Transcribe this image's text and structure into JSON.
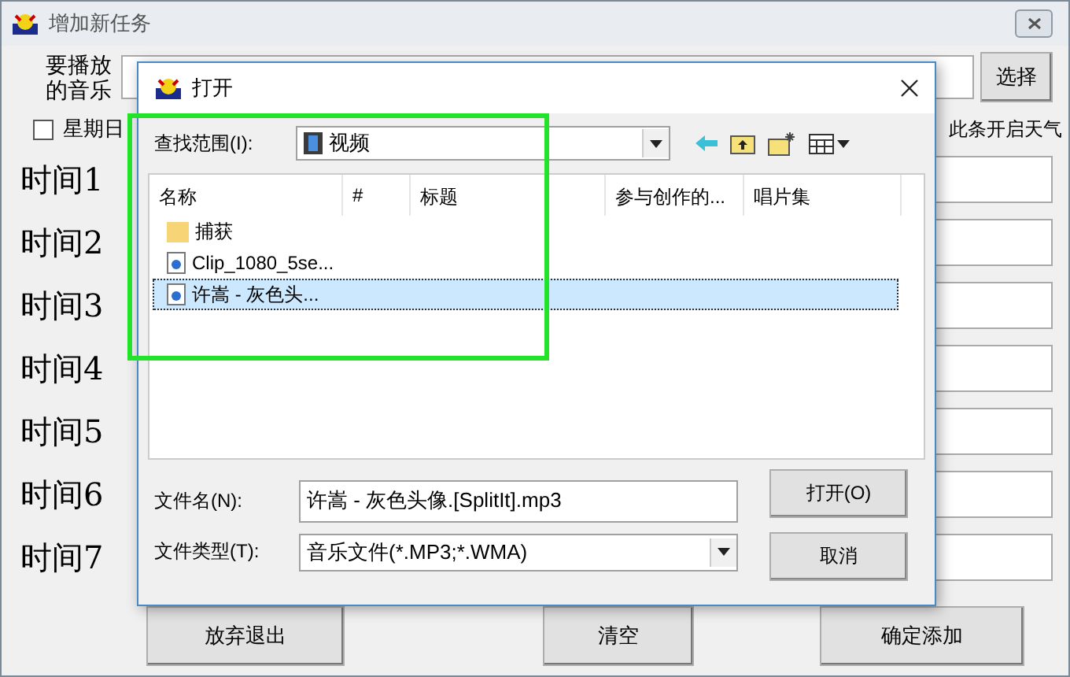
{
  "window": {
    "title": "增加新任务",
    "music_label": "要播放的音乐",
    "choose_button": "选择",
    "sunday": {
      "label": "星期日",
      "checked": false
    },
    "weather_label": "此条开启天气",
    "times": [
      {
        "label": "时间1"
      },
      {
        "label": "时间2"
      },
      {
        "label": "时间3"
      },
      {
        "label": "时间4"
      },
      {
        "label": "时间5"
      },
      {
        "label": "时间6"
      },
      {
        "label": "时间7"
      }
    ],
    "buttons": [
      "放弃退出",
      "清空",
      "确定添加"
    ]
  },
  "dialog": {
    "title": "打开",
    "look_in_label": "查找范围(I):",
    "look_in": "视频",
    "columns": [
      "名称",
      "#",
      "标题",
      "参与创作的...",
      "唱片集"
    ],
    "files": [
      {
        "kind": "folder",
        "name": "捕获",
        "selected": false
      },
      {
        "kind": "audio",
        "name": "Clip_1080_5se...",
        "selected": false
      },
      {
        "kind": "audio",
        "name": "许嵩 - 灰色头...",
        "selected": true
      }
    ],
    "filename_label": "文件名(N):",
    "filename": "许嵩 - 灰色头像.[SplitIt].mp3",
    "filetype_label": "文件类型(T):",
    "filetype": "音乐文件(*.MP3;*.WMA)",
    "open_button": "打开(O)",
    "cancel_button": "取消"
  }
}
